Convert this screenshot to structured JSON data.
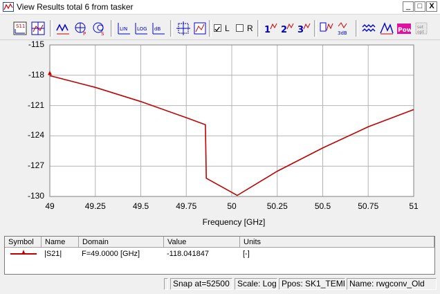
{
  "window": {
    "title": "View Results total 6 from tasker",
    "minimize": "_",
    "maximize": "□",
    "close": "X"
  },
  "toolbar": {
    "left_checkbox_label": "L",
    "right_checkbox_label": "R",
    "left_checked": true,
    "right_checked": false
  },
  "chart_data": {
    "type": "line",
    "xlabel": "Frequency [GHz]",
    "ylabel": "",
    "xlim": [
      49,
      51
    ],
    "ylim": [
      -130,
      -115
    ],
    "x_ticks": [
      "49",
      "49.25",
      "49.5",
      "49.75",
      "50",
      "50.25",
      "50.5",
      "50.75",
      "51"
    ],
    "y_ticks": [
      "-115",
      "-118",
      "-121",
      "-124",
      "-127",
      "-130"
    ],
    "line_color": "#c00000",
    "grid": true,
    "series": [
      {
        "name": "|S21|",
        "x": [
          49.0,
          49.25,
          49.5,
          49.75,
          49.855,
          49.86,
          50.03,
          50.25,
          50.5,
          50.75,
          51.0
        ],
        "y": [
          -118.04,
          -119.2,
          -120.6,
          -122.2,
          -122.9,
          -128.2,
          -129.9,
          -127.5,
          -125.2,
          -123.1,
          -121.4
        ]
      }
    ],
    "marker": {
      "x": 49.0,
      "y": -118.041847
    }
  },
  "table": {
    "headers": [
      "Symbol",
      "Name",
      "Domain",
      "Value",
      "Units"
    ],
    "rows": [
      {
        "name": "|S21|",
        "domain": "F=49.0000 [GHz]",
        "value": "-118.041847",
        "units": "[-]"
      }
    ]
  },
  "status": {
    "snap": "Snap at=52500",
    "scale": "Scale: Log.",
    "ppos": "Ppos: SK1_TEMPL",
    "name": "Name: rwgconv_Old"
  }
}
